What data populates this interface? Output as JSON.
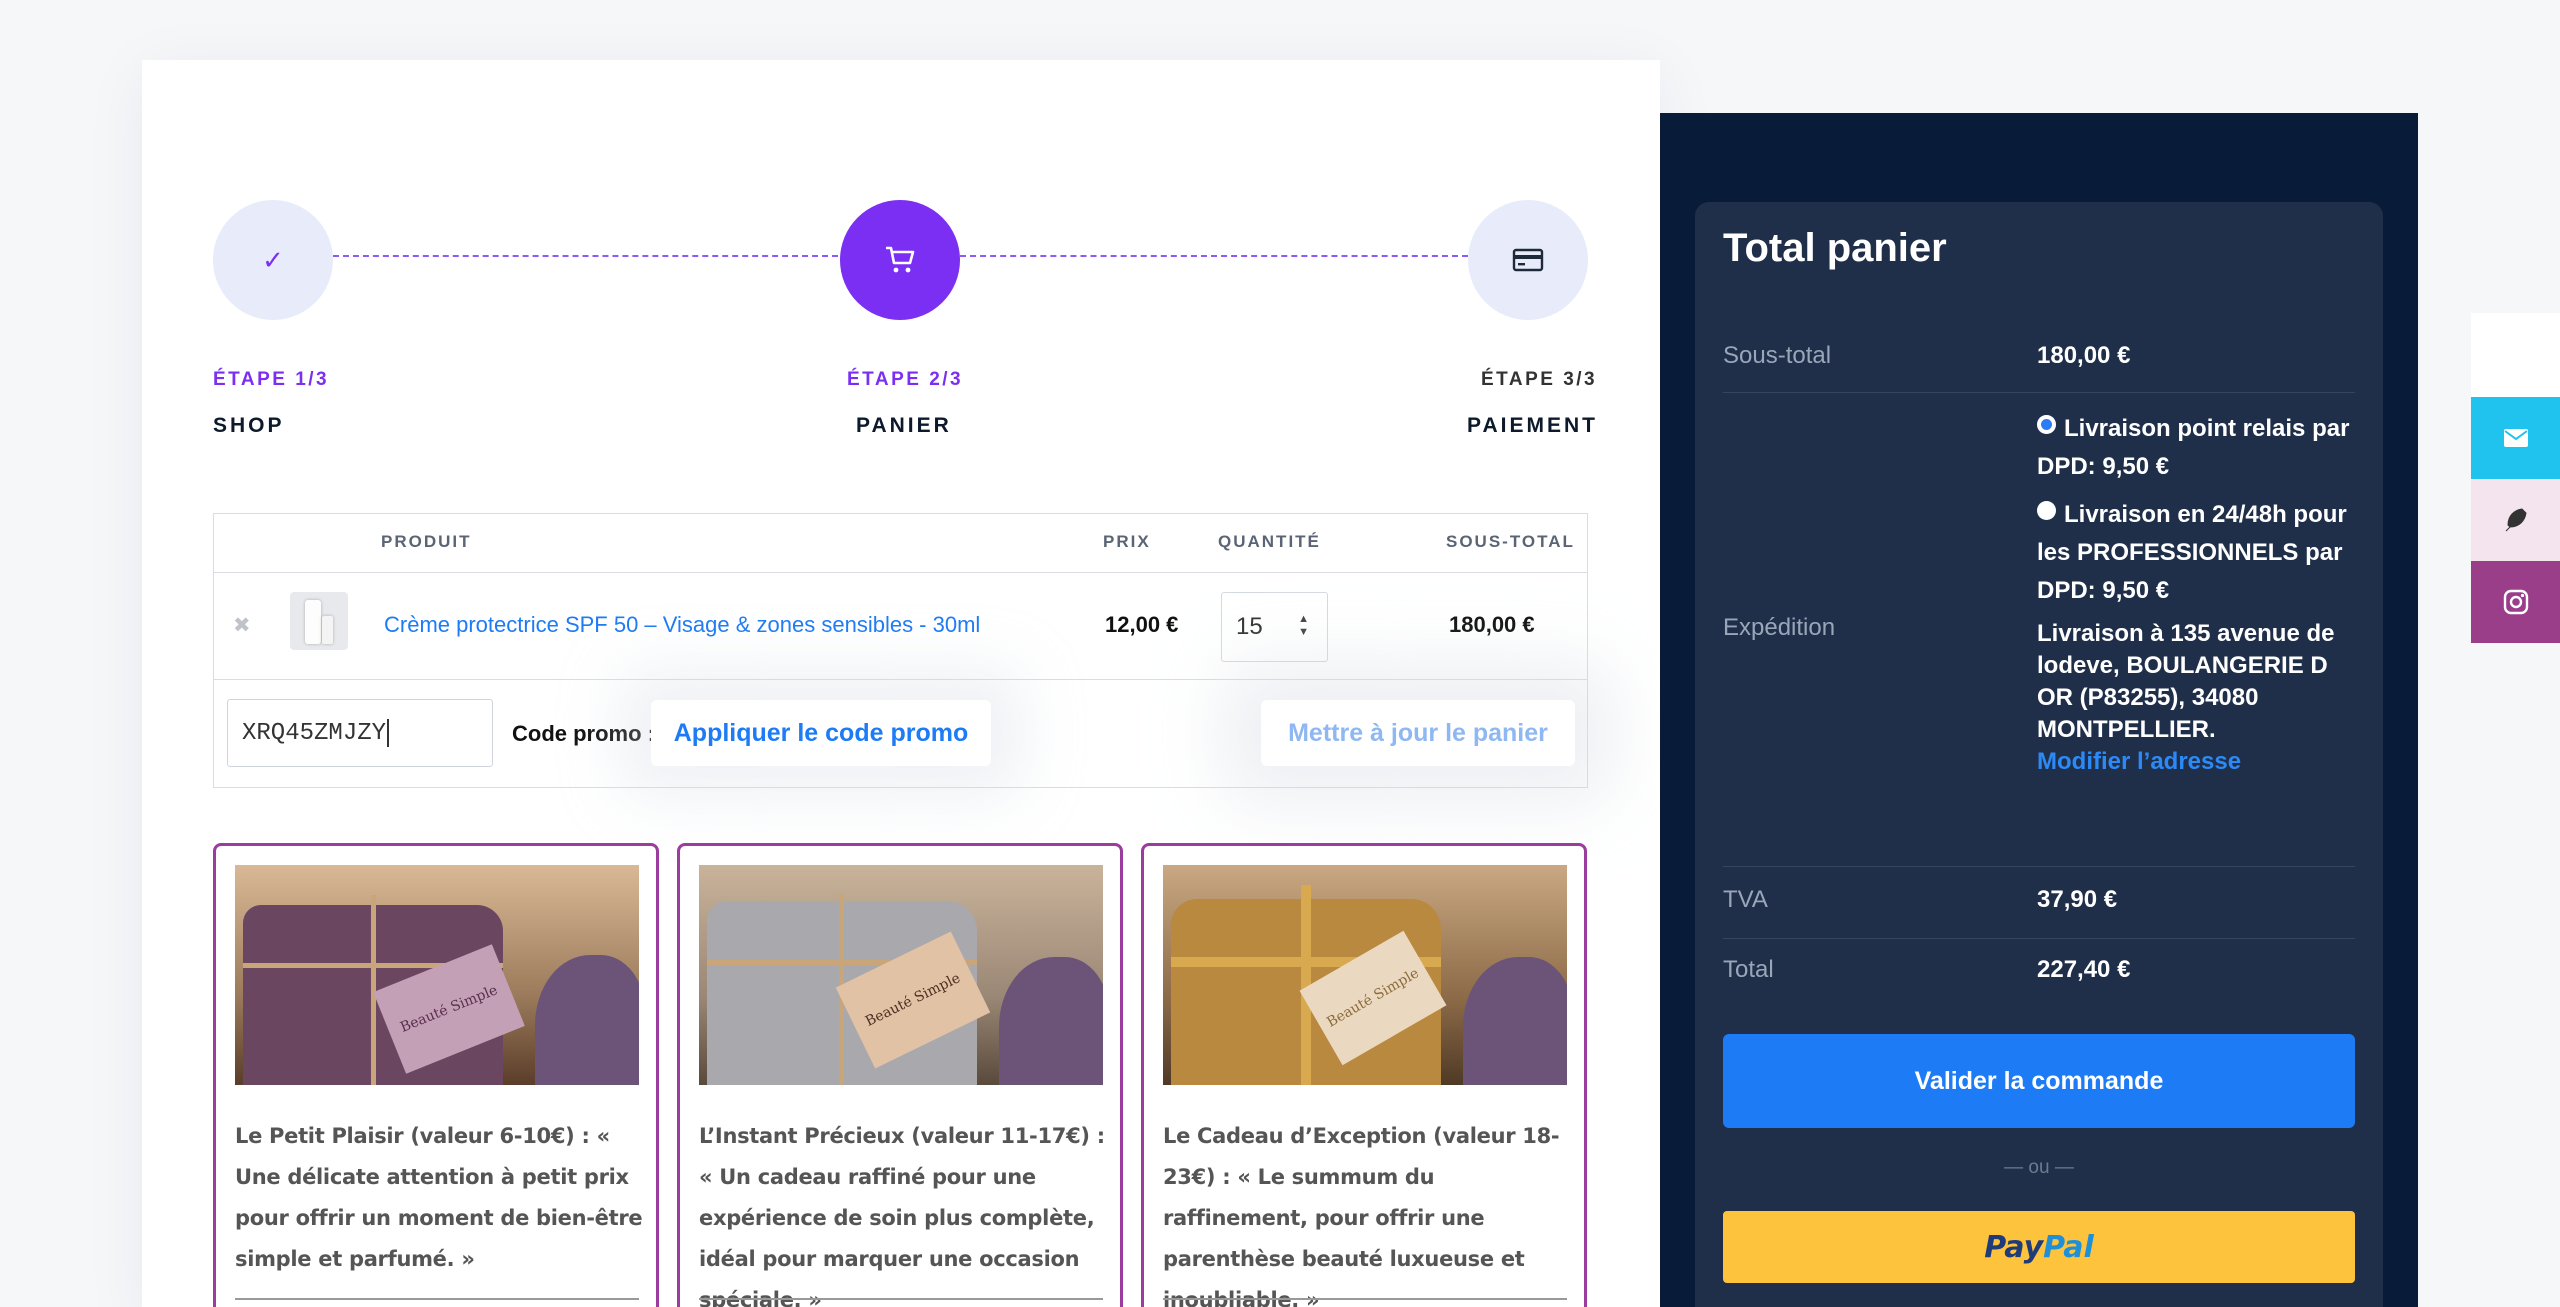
{
  "stepper": {
    "steps": [
      {
        "number": "ÉTAPE 1/3",
        "name": "SHOP"
      },
      {
        "number": "ÉTAPE 2/3",
        "name": "PANIER"
      },
      {
        "number": "ÉTAPE 3/3",
        "name": "PAIEMENT"
      }
    ],
    "done_glyph": "✓"
  },
  "cart": {
    "headers": {
      "product": "PRODUIT",
      "price": "PRIX",
      "quantity": "QUANTITÉ",
      "subtotal": "SOUS-TOTAL"
    },
    "items": [
      {
        "name": "Crème protectrice SPF 50 – Visage & zones sensibles - 30ml",
        "price": "12,00 €",
        "quantity": "15",
        "subtotal": "180,00 €"
      }
    ],
    "remove_glyph": "✖",
    "promo_label": "Code promo :",
    "promo_value": "XRQ45ZMJZY",
    "apply_label": "Appliquer le code promo",
    "update_label": "Mettre à jour le panier"
  },
  "gift_cards": [
    {
      "text": "Le Petit Plaisir (valeur 6-10€) : « Une délicate attention à petit prix pour offrir un moment de bien-être simple et parfumé. »",
      "tag": "Beauté Simple",
      "wrap_color": "#6a4660"
    },
    {
      "text": "L’Instant Précieux (valeur 11-17€) : « Un cadeau raffiné pour une expérience de soin plus complète, idéal pour marquer une occasion spéciale. »",
      "tag": "Beauté Simple",
      "wrap_color": "#a9a9ad"
    },
    {
      "text": "Le Cadeau d’Exception (valeur 18-23€) : « Le summum du raffinement, pour offrir une parenthèse beauté luxueuse et inoubliable. »",
      "tag": "Beauté Simple",
      "wrap_color": "#b8893e"
    }
  ],
  "summary": {
    "title": "Total panier",
    "subtotal_label": "Sous-total",
    "subtotal_value": "180,00 €",
    "shipping_label": "Expédition",
    "shipping_options": [
      {
        "label": "Livraison point relais par DPD: ",
        "price": "9,50 €",
        "selected": true
      },
      {
        "label": "Livraison en 24/48h pour les PROFESSIONNELS par DPD: ",
        "price": "9,50 €",
        "selected": false
      }
    ],
    "address_prefix": "Livraison à ",
    "address": "135 avenue de lodeve, BOULANGERIE D OR (P83255), 34080 MONTPELLIER.",
    "modify_address": "Modifier l’adresse",
    "tax_label": "TVA",
    "tax_value": "37,90 €",
    "total_label": "Total",
    "total_value": "227,40 €",
    "validate_label": "Valider la commande",
    "or_label": "— ou —",
    "paypal_pay": "Pay",
    "paypal_pal": "Pal"
  },
  "colors": {
    "accent": "#7b2ff2",
    "link": "#1d7bf5",
    "dark": "#081c3a",
    "card_border": "#9a3d9e",
    "paypal": "#fdc33c"
  },
  "social": [
    {
      "icon": "envelope-icon",
      "bg": "#20c3ee"
    },
    {
      "icon": "feather-icon",
      "bg": "#f3e4ee"
    },
    {
      "icon": "instagram-icon",
      "bg": "#9b3e8a"
    }
  ]
}
